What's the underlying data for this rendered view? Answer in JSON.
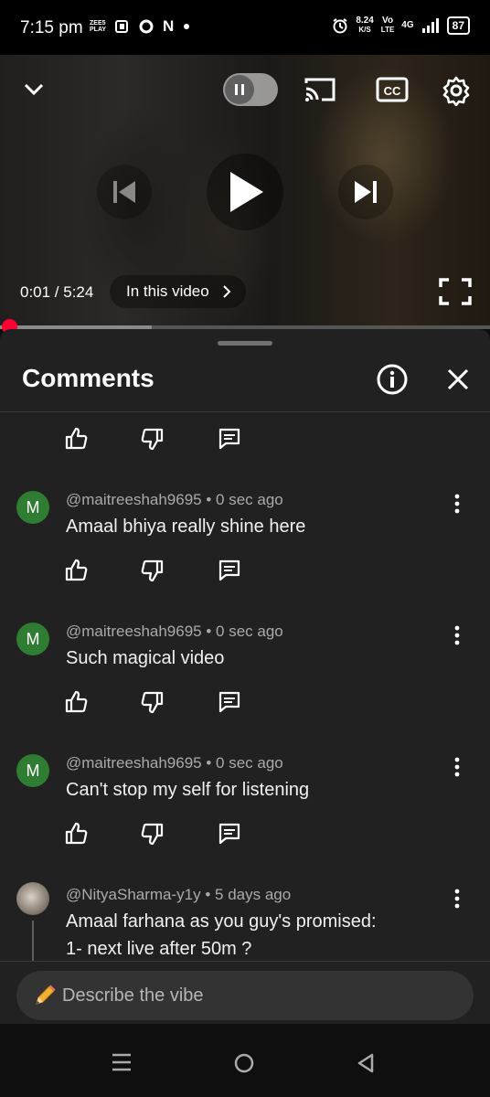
{
  "status_bar": {
    "time": "7:15 pm",
    "left_icons": [
      "zeeplay-icon",
      "sim-icon",
      "o-icon",
      "netflix-icon",
      "dot-icon"
    ],
    "net_speed": "8.24",
    "net_unit": "K/S",
    "volte": "Vo",
    "lte": "LTE",
    "network": "4G",
    "battery": "87"
  },
  "player": {
    "current_time": "0:01 / 5:24",
    "in_this_video": "In this video",
    "progress_fraction": 0.003,
    "buffer_fraction": 0.31
  },
  "comments_panel": {
    "title": "Comments",
    "items": [
      {
        "author": "@maitreeshah9695",
        "time": "0 sec ago",
        "text": "Amaal bhiya really shine here",
        "avatar": "M"
      },
      {
        "author": "@maitreeshah9695",
        "time": "0 sec ago",
        "text": "Such magical video",
        "avatar": "M"
      },
      {
        "author": "@maitreeshah9695",
        "time": "0 sec ago",
        "text": "Can't stop my self for listening",
        "avatar": "M"
      },
      {
        "author": "@NityaSharma-y1y",
        "time": "5 days ago",
        "text_line1": "Amaal farhana as you guy's promised:",
        "text_line2": "1- next live after 50m ?"
      }
    ]
  },
  "input": {
    "placeholder": "Describe the vibe"
  },
  "colors": {
    "accent": "#ff0033",
    "avatar_green": "#2e7d32",
    "sheet_bg": "#212121"
  }
}
